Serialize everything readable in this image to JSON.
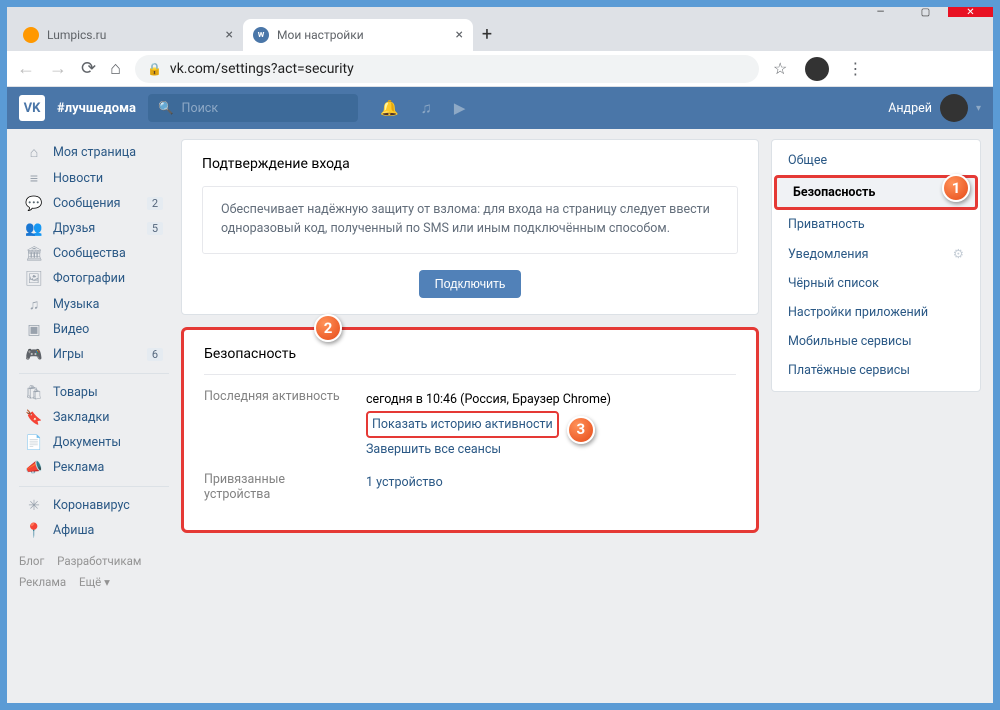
{
  "window": {
    "min": "—",
    "max": "▢",
    "close": "✕"
  },
  "tabs": [
    {
      "title": "Lumpics.ru"
    },
    {
      "title": "Мои настройки"
    }
  ],
  "newtab": "+",
  "addr": {
    "back": "←",
    "fwd": "→",
    "reload": "⟳",
    "home": "⌂",
    "lock": "🔒",
    "url": "vk.com/settings?act=security",
    "star": "☆",
    "menu": "⋮"
  },
  "vk": {
    "logo": "VK",
    "hashtag": "#лучшедома",
    "search_placeholder": "Поиск",
    "user": "Андрей",
    "chev": "▾"
  },
  "leftnav": {
    "items1": [
      {
        "ic": "⌂",
        "t": "Моя страница"
      },
      {
        "ic": "≡",
        "t": "Новости"
      },
      {
        "ic": "💬",
        "t": "Сообщения",
        "b": "2"
      },
      {
        "ic": "👥",
        "t": "Друзья",
        "b": "5"
      },
      {
        "ic": "🏛",
        "t": "Сообщества"
      },
      {
        "ic": "🖼",
        "t": "Фотографии"
      },
      {
        "ic": "♫",
        "t": "Музыка"
      },
      {
        "ic": "▣",
        "t": "Видео"
      },
      {
        "ic": "🎮",
        "t": "Игры",
        "b": "6"
      }
    ],
    "items2": [
      {
        "ic": "🛍",
        "t": "Товары"
      },
      {
        "ic": "🔖",
        "t": "Закладки"
      },
      {
        "ic": "📄",
        "t": "Документы"
      },
      {
        "ic": "📣",
        "t": "Реклама"
      }
    ],
    "items3": [
      {
        "ic": "✳",
        "t": "Коронавирус"
      },
      {
        "ic": "📍",
        "t": "Афиша"
      }
    ]
  },
  "footer": {
    "a": "Блог",
    "b": "Разработчикам",
    "c": "Реклама",
    "d": "Ещё ▾"
  },
  "confirm": {
    "title": "Подтверждение входа",
    "text": "Обеспечивает надёжную защиту от взлома: для входа на страницу следует ввести одноразовый код, полученный по SMS или иным подключённым способом.",
    "btn": "Подключить"
  },
  "security": {
    "title": "Безопасность",
    "last_label": "Последняя активность",
    "last_value": "сегодня в 10:46 (Россия, Браузер Chrome)",
    "history_link": "Показать историю активности",
    "end_link": "Завершить все сеансы",
    "dev_label": "Привязанные устройства",
    "dev_link": "1 устройство"
  },
  "rightmenu": [
    "Общее",
    "Безопасность",
    "Приватность",
    "Уведомления",
    "Чёрный список",
    "Настройки приложений",
    "Мобильные сервисы",
    "Платёжные сервисы"
  ],
  "bubbles": {
    "b1": "1",
    "b2": "2",
    "b3": "3"
  }
}
